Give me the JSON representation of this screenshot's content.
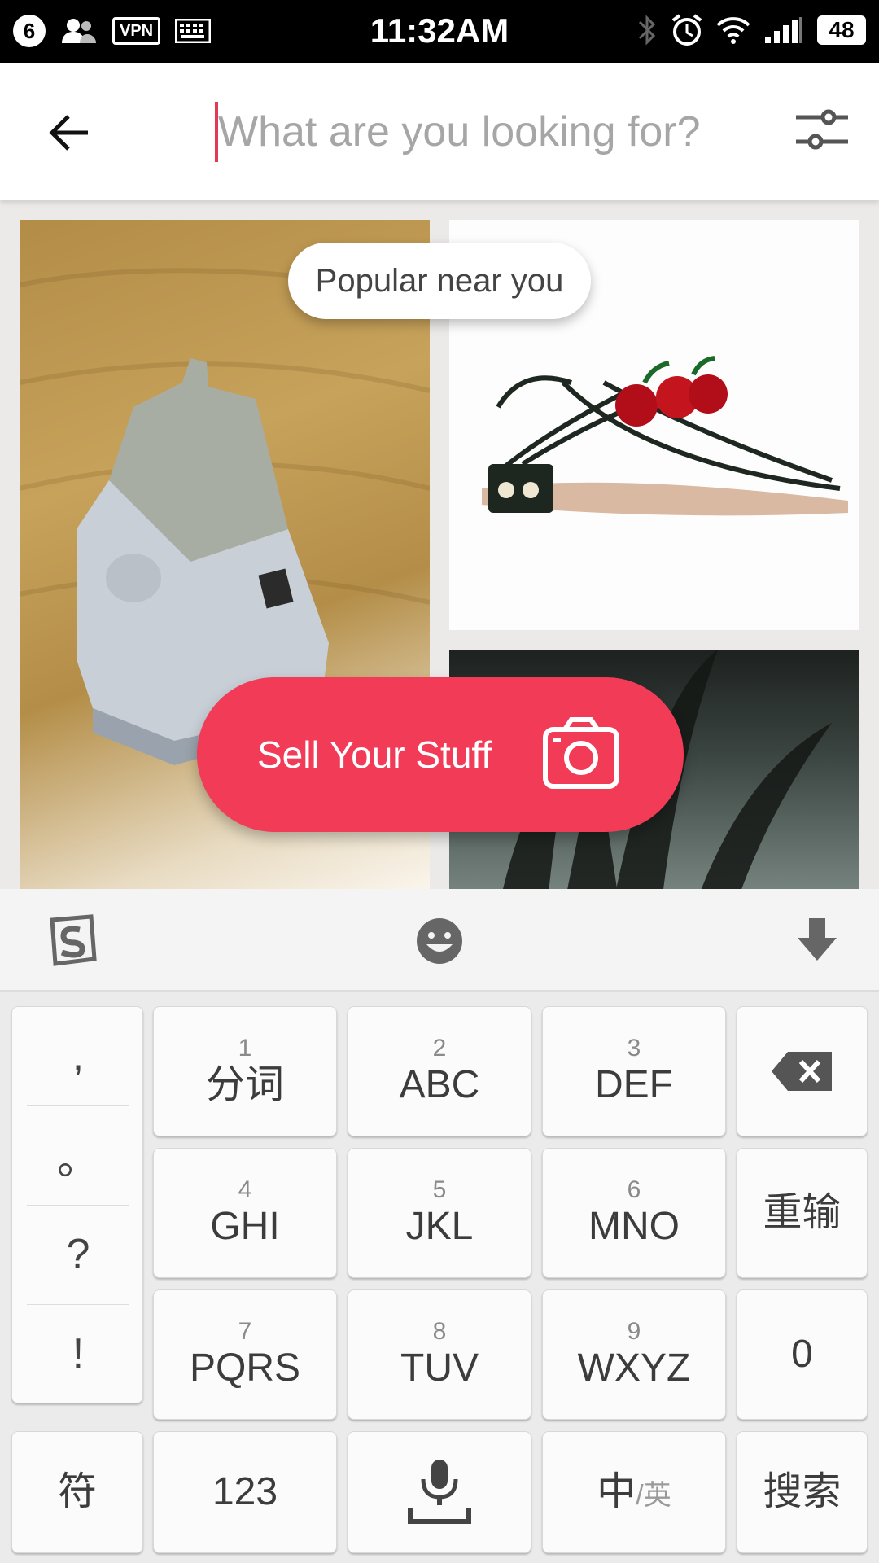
{
  "status_bar": {
    "notification_count": "6",
    "vpn_label": "VPN",
    "time": "11:32AM",
    "battery": "48"
  },
  "search": {
    "placeholder": "What are you looking for?",
    "value": ""
  },
  "feed": {
    "popular_label": "Popular near you"
  },
  "sell_button": {
    "label": "Sell Your Stuff"
  },
  "keyboard": {
    "punctuation": [
      ",",
      "。",
      "?",
      "!"
    ],
    "keys": [
      {
        "num": "1",
        "label": "分词"
      },
      {
        "num": "2",
        "label": "ABC"
      },
      {
        "num": "3",
        "label": "DEF"
      },
      {
        "num": "4",
        "label": "GHI"
      },
      {
        "num": "5",
        "label": "JKL"
      },
      {
        "num": "6",
        "label": "MNO"
      },
      {
        "num": "7",
        "label": "PQRS"
      },
      {
        "num": "8",
        "label": "TUV"
      },
      {
        "num": "9",
        "label": "WXYZ"
      }
    ],
    "reinput": "重输",
    "zero": "0",
    "symbols": "符",
    "numbers": "123",
    "lang_main": "中",
    "lang_alt": "/英",
    "search_key": "搜索"
  },
  "colors": {
    "accent": "#f23b57",
    "caret": "#e23a52"
  }
}
